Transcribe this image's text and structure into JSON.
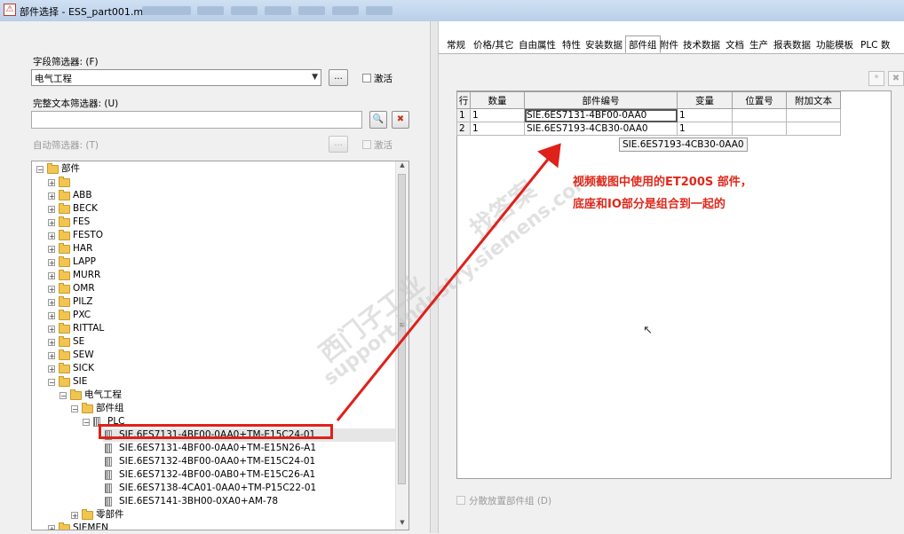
{
  "window": {
    "title": "部件选择 - ESS_part001.mdb"
  },
  "filters": {
    "field_filter_label": "字段筛选器: (F)",
    "field_filter_value": "电气工程",
    "field_filter_button": "...",
    "field_filter_active_label": "激活",
    "fulltext_filter_label": "完整文本筛选器: (U)",
    "fulltext_filter_value": "",
    "auto_filter_label": "自动筛选器: (T)",
    "auto_filter_button": "...",
    "auto_filter_active_label": "激活"
  },
  "tree": {
    "nodes": [
      {
        "label": "部件",
        "level": 0,
        "expanded": true,
        "icon": "folder-icon"
      },
      {
        "label": "",
        "level": 1,
        "expanded": false,
        "icon": "folder-icon"
      },
      {
        "label": "ABB",
        "level": 1,
        "expanded": false,
        "icon": "folder-icon"
      },
      {
        "label": "BECK",
        "level": 1,
        "expanded": false,
        "icon": "folder-icon"
      },
      {
        "label": "FES",
        "level": 1,
        "expanded": false,
        "icon": "folder-icon"
      },
      {
        "label": "FESTO",
        "level": 1,
        "expanded": false,
        "icon": "folder-icon"
      },
      {
        "label": "HAR",
        "level": 1,
        "expanded": false,
        "icon": "folder-icon"
      },
      {
        "label": "LAPP",
        "level": 1,
        "expanded": false,
        "icon": "folder-icon"
      },
      {
        "label": "MURR",
        "level": 1,
        "expanded": false,
        "icon": "folder-icon"
      },
      {
        "label": "OMR",
        "level": 1,
        "expanded": false,
        "icon": "folder-icon"
      },
      {
        "label": "PILZ",
        "level": 1,
        "expanded": false,
        "icon": "folder-icon"
      },
      {
        "label": "PXC",
        "level": 1,
        "expanded": false,
        "icon": "folder-icon"
      },
      {
        "label": "RITTAL",
        "level": 1,
        "expanded": false,
        "icon": "folder-icon"
      },
      {
        "label": "SE",
        "level": 1,
        "expanded": false,
        "icon": "folder-icon"
      },
      {
        "label": "SEW",
        "level": 1,
        "expanded": false,
        "icon": "folder-icon"
      },
      {
        "label": "SICK",
        "level": 1,
        "expanded": false,
        "icon": "folder-icon"
      },
      {
        "label": "SIE",
        "level": 1,
        "expanded": true,
        "icon": "folder-icon"
      },
      {
        "label": "电气工程",
        "level": 2,
        "expanded": true,
        "icon": "folder-icon"
      },
      {
        "label": "部件组",
        "level": 3,
        "expanded": true,
        "icon": "folder-icon"
      },
      {
        "label": "PLC",
        "level": 4,
        "expanded": true,
        "icon": "part-group-icon"
      },
      {
        "label": "SIE.6ES7131-4BF00-0AA0+TM-E15C24-01",
        "level": 5,
        "icon": "part-icon",
        "selected": true
      },
      {
        "label": "SIE.6ES7131-4BF00-0AA0+TM-E15N26-A1",
        "level": 5,
        "icon": "part-icon"
      },
      {
        "label": "SIE.6ES7132-4BF00-0AA0+TM-E15C24-01",
        "level": 5,
        "icon": "part-icon"
      },
      {
        "label": "SIE.6ES7132-4BF00-0AB0+TM-E15C26-A1",
        "level": 5,
        "icon": "part-icon"
      },
      {
        "label": "SIE.6ES7138-4CA01-0AA0+TM-P15C22-01",
        "level": 5,
        "icon": "part-icon"
      },
      {
        "label": "SIE.6ES7141-3BH00-0XA0+AM-78",
        "level": 5,
        "icon": "part-icon"
      },
      {
        "label": "零部件",
        "level": 3,
        "expanded": false,
        "icon": "folder-icon"
      },
      {
        "label": "SIEMEN",
        "level": 1,
        "expanded": false,
        "icon": "folder-icon"
      }
    ]
  },
  "tabs": [
    {
      "label": "常规"
    },
    {
      "label": "价格/其它"
    },
    {
      "label": "自由属性"
    },
    {
      "label": "特性"
    },
    {
      "label": "安装数据"
    },
    {
      "label": "部件组",
      "active": true
    },
    {
      "label": "附件"
    },
    {
      "label": "技术数据"
    },
    {
      "label": "文档"
    },
    {
      "label": "生产"
    },
    {
      "label": "报表数据"
    },
    {
      "label": "功能模板"
    },
    {
      "label": "PLC 数"
    }
  ],
  "grid": {
    "headers": [
      "行",
      "数量",
      "部件编号",
      "变量",
      "位置号",
      "附加文本"
    ],
    "rows": [
      [
        "1",
        "1",
        "SIE.6ES7131-4BF00-0AA0",
        "1",
        "",
        ""
      ],
      [
        "2",
        "1",
        "SIE.6ES7193-4CB30-0AA0",
        "1",
        "",
        ""
      ]
    ],
    "tooltip": "SIE.6ES7193-4CB30-0AA0"
  },
  "toolbar_right": {
    "new_label": "*",
    "delete_label": "✖"
  },
  "bottom": {
    "distribute_checkbox_label": "分散放置部件组 (D)"
  },
  "annotation": {
    "line1": "视频截图中使用的ET200S 部件，",
    "line2": "底座和IO部分是组合到一起的"
  },
  "watermark": {
    "line1": "西门子工业",
    "line2": "support.industry.siemens.com",
    "line3": "找答案"
  },
  "colors": {
    "annotation_red": "#e0281a",
    "titlebar": "#c4d8ee"
  }
}
